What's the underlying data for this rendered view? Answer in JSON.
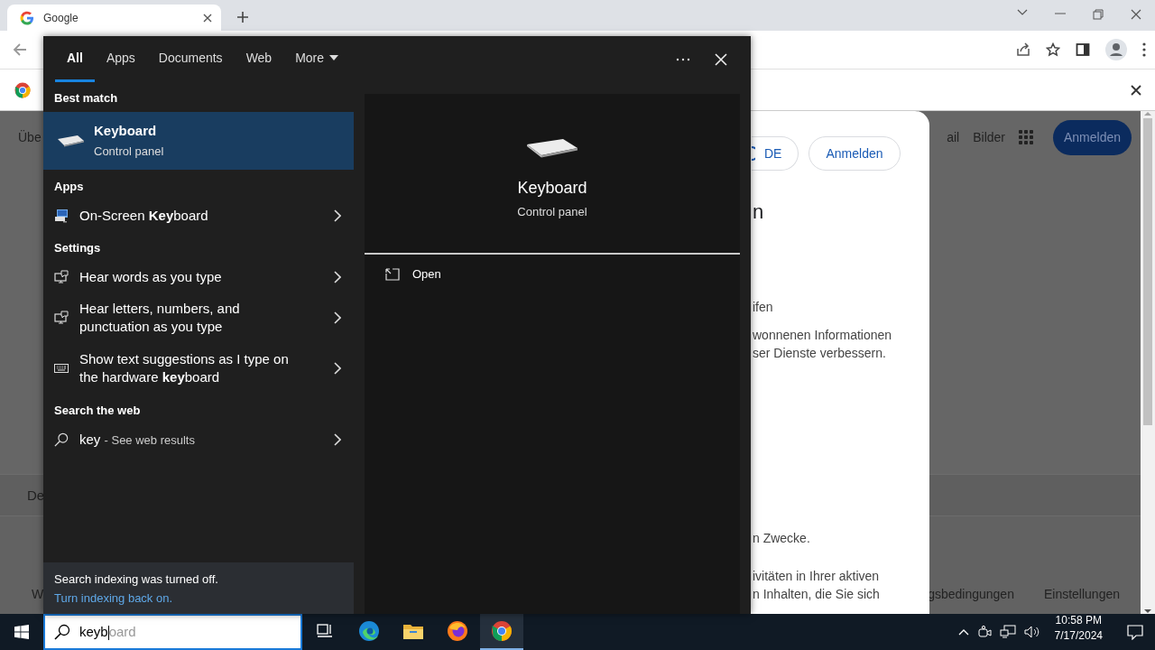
{
  "browser": {
    "tab": {
      "title": "Google"
    }
  },
  "page": {
    "left_fragments": [
      "Übe",
      "De",
      "W"
    ],
    "header_links": [
      "ail",
      "Bilder"
    ],
    "signin_button": "Anmelden",
    "footer_links": [
      "gsbedingungen",
      "Einstellungen"
    ],
    "dialog": {
      "language_button": "DE",
      "signin_button": "Anmelden",
      "heading": "n",
      "paragraphs": [
        [
          "ifen"
        ],
        [
          "wonnenen Informationen",
          "ser Dienste verbessern."
        ],
        [
          "n Zwecke."
        ],
        [
          "ivitäten in Ihrer aktiven",
          "n Inhalten, die Sie sich"
        ]
      ]
    }
  },
  "search": {
    "tabs": [
      {
        "kind": "filter",
        "label": "All",
        "selected": true
      },
      {
        "kind": "filter",
        "label": "Apps",
        "selected": false
      },
      {
        "kind": "filter",
        "label": "Documents",
        "selected": false
      },
      {
        "kind": "filter",
        "label": "Web",
        "selected": false
      },
      {
        "kind": "menu",
        "label": "More",
        "selected": false
      }
    ],
    "groups": [
      {
        "heading": "Best match",
        "items": [
          {
            "kind": "best",
            "title": "Keyboard",
            "subtitle": "Control panel",
            "selected": true
          }
        ]
      },
      {
        "heading": "Apps",
        "items": [
          {
            "kind": "app",
            "title": "On-Screen **Key**board",
            "selected": false
          }
        ]
      },
      {
        "heading": "Settings",
        "items": [
          {
            "kind": "speech_setting",
            "title": "Hear words as you type",
            "selected": false
          },
          {
            "kind": "speech_setting",
            "title": "Hear letters, numbers, and punctuation as you type",
            "selected": false
          },
          {
            "kind": "keyboard_setting",
            "title": "Show text suggestions as I type on the hardware **key**board",
            "selected": false
          }
        ]
      },
      {
        "heading": "Search the web",
        "items": [
          {
            "kind": "web",
            "title": "key",
            "suffix": "- See web results",
            "selected": false
          }
        ]
      }
    ],
    "preview": {
      "title": "Keyboard",
      "subtitle": "Control panel",
      "actions": [
        "Open"
      ]
    },
    "footer": {
      "notice": "Search indexing was turned off.",
      "link": "Turn indexing back on."
    }
  },
  "taskbar": {
    "search_box": {
      "value": "keyb",
      "completion": "oard"
    },
    "apps": [
      {
        "kind": "task_view",
        "running": false
      },
      {
        "kind": "edge",
        "running": false
      },
      {
        "kind": "explorer",
        "running": false
      },
      {
        "kind": "firefox",
        "running": false
      },
      {
        "kind": "chrome",
        "running": true
      }
    ],
    "time": "10:58 PM",
    "date": "7/17/2024"
  }
}
